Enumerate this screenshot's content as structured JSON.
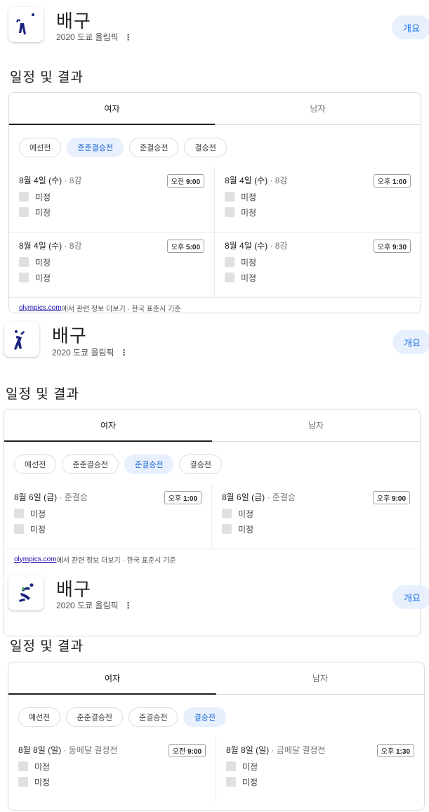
{
  "blocks": [
    {
      "title": "배구",
      "subtitle": "2020 도쿄 올림픽",
      "more": "⋮",
      "overview": "개요",
      "section": "일정 및 결과",
      "tabs": [
        "여자",
        "남자"
      ],
      "chips": [
        "예선전",
        "준준결승전",
        "준결승전",
        "결승전"
      ],
      "selected_chip": 1,
      "matches": [
        {
          "date": "8월 4일 (수)",
          "round": " · 8강",
          "ampm": "오전",
          "time": "9:00",
          "team1": "미정",
          "team2": "미정"
        },
        {
          "date": "8월 4일 (수)",
          "round": " · 8강",
          "ampm": "오후",
          "time": "1:00",
          "team1": "미정",
          "team2": "미정"
        },
        {
          "date": "8월 4일 (수)",
          "round": " · 8강",
          "ampm": "오후",
          "time": "5:00",
          "team1": "미정",
          "team2": "미정"
        },
        {
          "date": "8월 4일 (수)",
          "round": " · 8강",
          "ampm": "오후",
          "time": "9:30",
          "team1": "미정",
          "team2": "미정"
        }
      ],
      "footer_link": "olympics.com",
      "footer_text": "에서 관련 정보 더보기 · 한국 표준시 기준"
    },
    {
      "title": "배구",
      "subtitle": "2020 도쿄 올림픽",
      "more": "⋮",
      "overview": "개요",
      "section": "일정 및 결과",
      "tabs": [
        "여자",
        "남자"
      ],
      "chips": [
        "예선전",
        "준준결승전",
        "준결승전",
        "결승전"
      ],
      "selected_chip": 2,
      "matches": [
        {
          "date": "8월 6일 (금)",
          "round": " · 준결승",
          "ampm": "오후",
          "time": "1:00",
          "team1": "미정",
          "team2": "미정"
        },
        {
          "date": "8월 6일 (금)",
          "round": " · 준결승",
          "ampm": "오후",
          "time": "9:00",
          "team1": "미정",
          "team2": "미정"
        }
      ],
      "footer_link": "olympics.com",
      "footer_text": "에서 관련 정보 더보기 · 한국 표준시 기준"
    },
    {
      "title": "배구",
      "subtitle": "2020 도쿄 올림픽",
      "more": "⋮",
      "overview": "개요",
      "section": "일정 및 결과",
      "tabs": [
        "여자",
        "남자"
      ],
      "chips": [
        "예선전",
        "준준결승전",
        "준결승전",
        "결승전"
      ],
      "selected_chip": 3,
      "matches": [
        {
          "date": "8월 8일 (일)",
          "round": " · 동메달 결정전",
          "ampm": "오전",
          "time": "9:00",
          "team1": "미정",
          "team2": "미정"
        },
        {
          "date": "8월 8일 (일)",
          "round": " · 금메달 결정전",
          "ampm": "오후",
          "time": "1:30",
          "team1": "미정",
          "team2": "미정"
        }
      ],
      "footer_link": "",
      "footer_text": ""
    }
  ],
  "colors": {
    "accent": "#1a73e8",
    "chip_selected_bg": "#e8f0fe",
    "icon_blue": "#1a237e"
  }
}
